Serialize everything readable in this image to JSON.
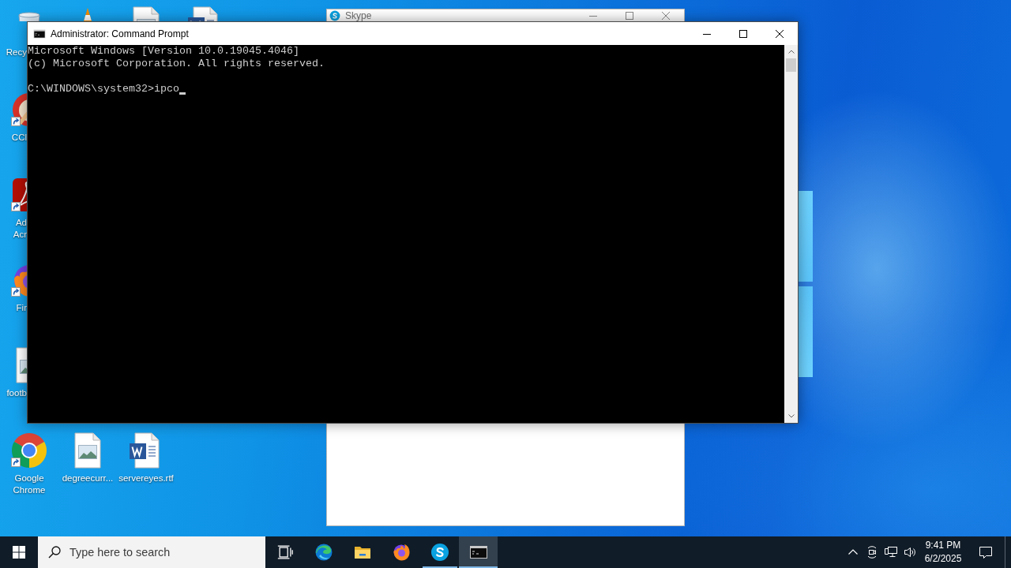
{
  "desktop": {
    "left_column": [
      {
        "kind": "recycle-bin",
        "label": "Recy",
        "shortcut": false
      },
      {
        "kind": "brush-logo",
        "label": "CCl",
        "shortcut": true
      },
      {
        "kind": "swirl-tile",
        "label": "Ad\nAcr",
        "shortcut": true
      },
      {
        "kind": "fox-globe",
        "label": "Fir",
        "shortcut": true
      },
      {
        "kind": "image-file",
        "label": "footb",
        "shortcut": false
      }
    ],
    "top_row": [
      {
        "kind": "traffic-cone"
      },
      {
        "kind": "image-file"
      },
      {
        "kind": "word-document"
      }
    ],
    "bottom_row": [
      {
        "kind": "ring-logo",
        "label": "Google Chrome",
        "shortcut": true
      },
      {
        "kind": "image-file",
        "label": "degreecurr...",
        "shortcut": false
      },
      {
        "kind": "word-document",
        "label": "servereyes.rtf",
        "shortcut": false
      }
    ]
  },
  "skype_window": {
    "title": "Skype"
  },
  "console_window": {
    "title": "Administrator: Command Prompt",
    "output": [
      "Microsoft Windows [Version 10.0.19045.4046]",
      "(c) Microsoft Corporation. All rights reserved."
    ],
    "prompt_line": "C:\\WINDOWS\\system32>ipco"
  },
  "taskbar": {
    "search": {
      "placeholder": "Type here to search"
    },
    "apps": [
      {
        "kind": "browser-swirl",
        "running": false,
        "selected": false
      },
      {
        "kind": "folder",
        "running": false,
        "selected": false
      },
      {
        "kind": "fox-globe",
        "running": false,
        "selected": false
      },
      {
        "kind": "s-badge",
        "running": true,
        "selected": false
      },
      {
        "kind": "terminal",
        "running": true,
        "selected": true
      }
    ],
    "clock": {
      "time": "9:41 PM",
      "date": "6/2/2025"
    }
  }
}
